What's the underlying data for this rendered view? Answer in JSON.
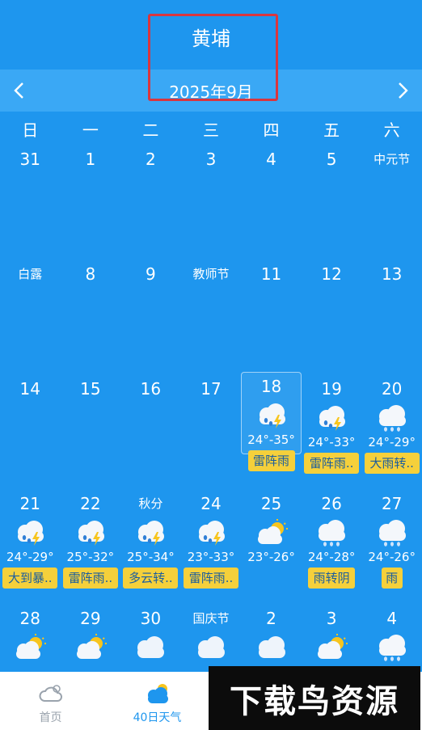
{
  "header": {
    "city": "黄埔",
    "month": "2025年9月"
  },
  "weekdays": [
    "日",
    "一",
    "二",
    "三",
    "四",
    "五",
    "六"
  ],
  "rows": [
    [
      {
        "day": "31"
      },
      {
        "day": "1"
      },
      {
        "day": "2"
      },
      {
        "day": "3"
      },
      {
        "day": "4"
      },
      {
        "day": "5"
      },
      {
        "day": "中元节",
        "festival": true
      }
    ],
    [
      {
        "day": "白露",
        "festival": true
      },
      {
        "day": "8"
      },
      {
        "day": "9"
      },
      {
        "day": "教师节",
        "festival": true
      },
      {
        "day": "11"
      },
      {
        "day": "12"
      },
      {
        "day": "13"
      }
    ],
    [
      {
        "day": "14"
      },
      {
        "day": "15"
      },
      {
        "day": "16"
      },
      {
        "day": "17"
      },
      {
        "day": "18",
        "selected": true,
        "icon": "thunder-rain-icon",
        "temp": "24°-35°",
        "desc": "雷阵雨"
      },
      {
        "day": "19",
        "icon": "thunder-rain-icon",
        "temp": "24°-33°",
        "desc": "雷阵雨.."
      },
      {
        "day": "20",
        "icon": "rain-icon",
        "temp": "24°-29°",
        "desc": "大雨转.."
      }
    ],
    [
      {
        "day": "21",
        "icon": "thunder-rain-icon",
        "temp": "24°-29°",
        "desc": "大到暴.."
      },
      {
        "day": "22",
        "icon": "thunder-rain-icon",
        "temp": "25°-32°",
        "desc": "雷阵雨.."
      },
      {
        "day": "秋分",
        "festival": true,
        "icon": "thunder-rain-icon",
        "temp": "25°-34°",
        "desc": "多云转.."
      },
      {
        "day": "24",
        "icon": "thunder-rain-icon",
        "temp": "23°-33°",
        "desc": "雷阵雨.."
      },
      {
        "day": "25",
        "icon": "partly-cloudy-icon",
        "temp": "23°-26°"
      },
      {
        "day": "26",
        "icon": "rain-icon",
        "temp": "24°-28°",
        "desc": "雨转阴"
      },
      {
        "day": "27",
        "icon": "rain-icon",
        "temp": "24°-26°",
        "desc": "雨"
      }
    ],
    [
      {
        "day": "28",
        "icon": "partly-cloudy-icon"
      },
      {
        "day": "29",
        "icon": "partly-cloudy-icon"
      },
      {
        "day": "30",
        "icon": "cloudy-icon"
      },
      {
        "day": "国庆节",
        "festival": true,
        "icon": "cloudy-icon"
      },
      {
        "day": "2",
        "icon": "cloudy-icon"
      },
      {
        "day": "3",
        "icon": "partly-cloudy-icon"
      },
      {
        "day": "4",
        "icon": "rain-icon"
      }
    ]
  ],
  "tabs": [
    {
      "label": "首页",
      "icon": "cloud-outline-icon",
      "active": false
    },
    {
      "label": "40日天气",
      "icon": "cloud-sun-icon",
      "active": true
    }
  ],
  "watermark": "下载鸟资源",
  "colors": {
    "background": "#1e96ee",
    "month_bar": "#3aa8f5",
    "badge": "#f5d03b",
    "highlight_box": "#d9363e"
  }
}
